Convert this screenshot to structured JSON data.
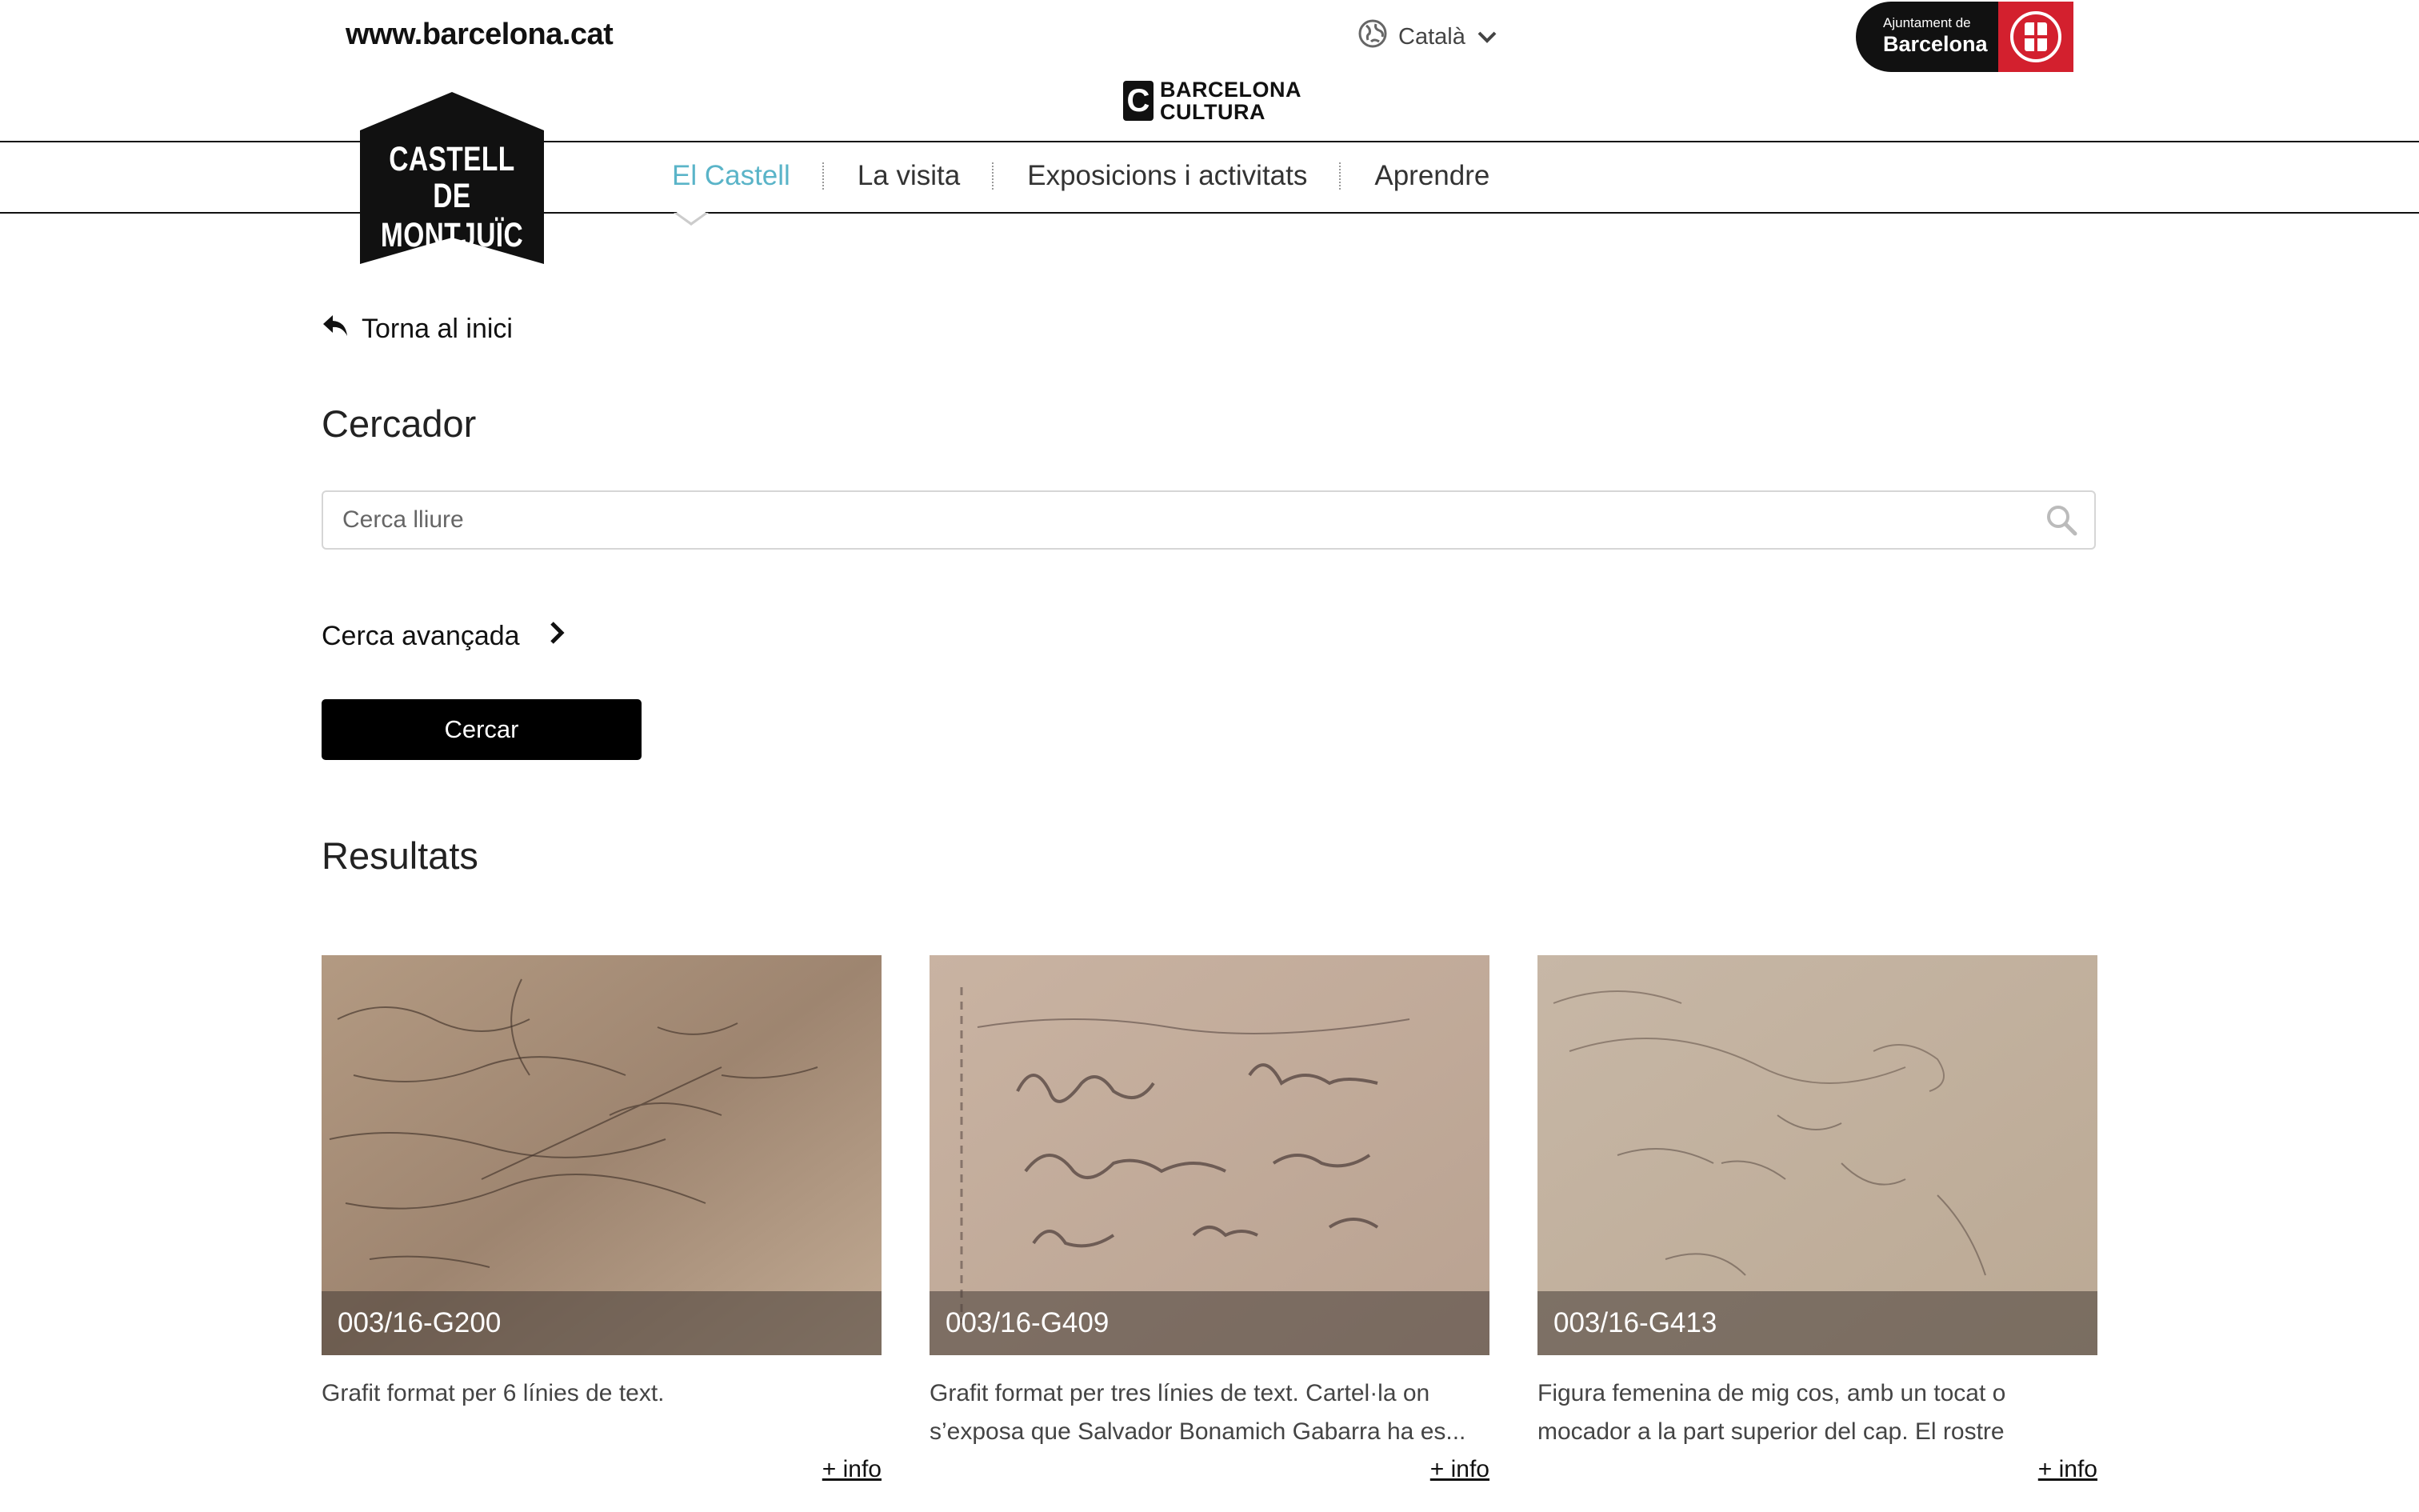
{
  "header": {
    "site_link": "www.barcelona.cat",
    "language": "Català",
    "ajuntament_small": "Ajuntament de",
    "ajuntament_big": "Barcelona",
    "barcelona_cultura_line1": "BARCELONA",
    "barcelona_cultura_line2": "CULTURA",
    "castle_logo_line1": "CASTELL",
    "castle_logo_line2": "DE MONTJUÏC"
  },
  "nav": {
    "items": [
      {
        "label": "El Castell",
        "active": true
      },
      {
        "label": "La visita",
        "active": false
      },
      {
        "label": "Exposicions i activitats",
        "active": false
      },
      {
        "label": "Aprendre",
        "active": false
      }
    ]
  },
  "main": {
    "back_label": "Torna al inici",
    "search_title": "Cercador",
    "search_placeholder": "Cerca lliure",
    "advanced_label": "Cerca avançada",
    "search_button": "Cercar",
    "results_title": "Resultats"
  },
  "results": [
    {
      "code": "003/16-G200",
      "description": "Grafit format per 6 línies de text.",
      "more": "+ info",
      "image": "graffiti-photo"
    },
    {
      "code": "003/16-G409",
      "description": "Grafit format per tres línies de text. Cartel·la on s’exposa que Salvador Bonamich Gabarra ha es...",
      "more": "+ info",
      "image": "graffiti-photo"
    },
    {
      "code": "003/16-G413",
      "description": "Figura femenina de mig cos, amb un tocat o mocador a la part superior del cap. El rostre perfectamen...",
      "more": "+ info",
      "image": "graffiti-photo"
    }
  ],
  "colors": {
    "accent": "#5ab4c8",
    "button": "#000000",
    "ajuntament_red": "#d3202e"
  }
}
